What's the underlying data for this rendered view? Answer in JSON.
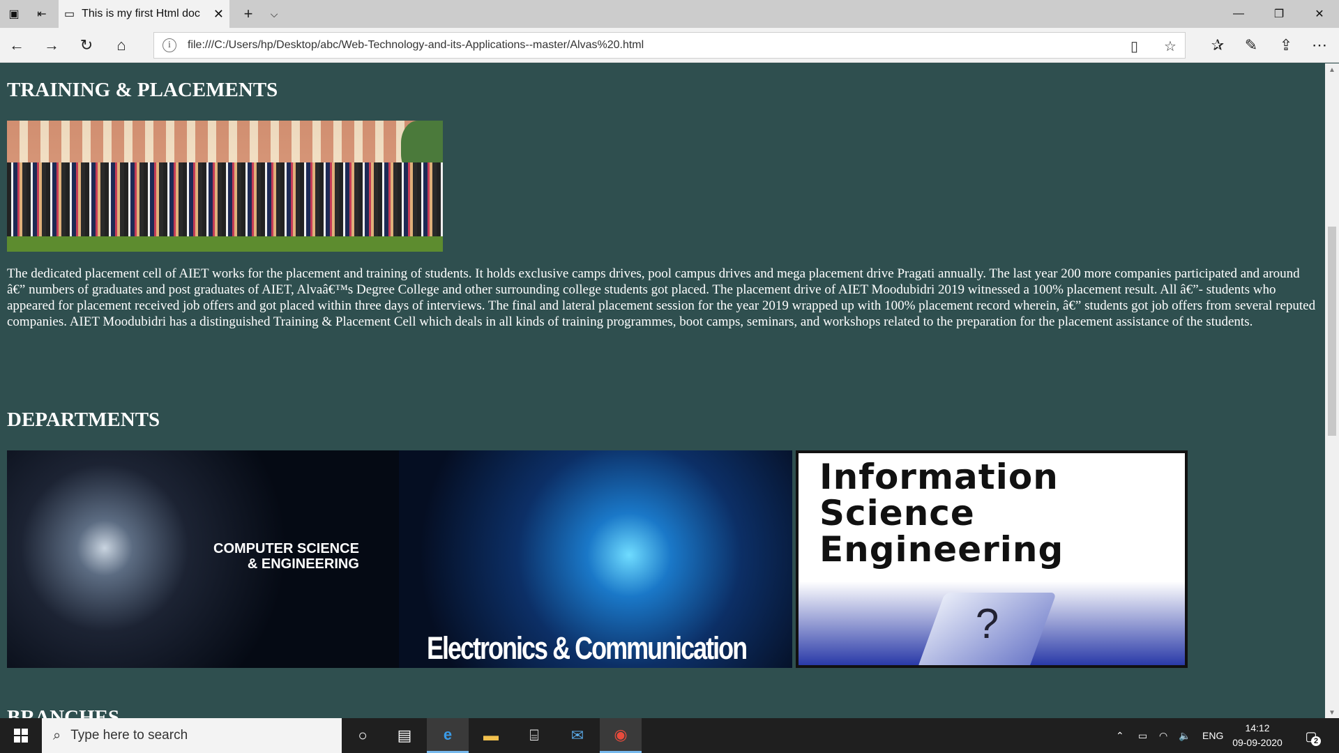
{
  "browser": {
    "tab_title": "This is my first Html doc",
    "tab_close": "✕",
    "new_tab": "+",
    "tab_menu": "⌵",
    "window": {
      "minimize": "—",
      "restore": "❐",
      "close": "✕"
    },
    "address_url": "file:///C:/Users/hp/Desktop/abc/Web-Technology-and-its-Applications--master/Alvas%20.html",
    "icons": [
      "back-icon",
      "forward-icon",
      "refresh-icon",
      "home-icon",
      "info-icon",
      "reading-view-icon",
      "favorite-star-icon",
      "favorites-list-icon",
      "pen-icon",
      "share-icon",
      "more-icon"
    ]
  },
  "page": {
    "training_heading": "TRAINING & PLACEMENTS",
    "training_paragraph": "The dedicated placement cell of AIET works for the placement and training of students. It holds exclusive camps drives, pool campus drives and mega placement drive Pragati annually. The last year 200 more companies participated and around â€” numbers of graduates and post graduates of AIET, Alvaâ€™s Degree College and other surrounding college students got placed. The placement drive of AIET Moodubidri 2019 witnessed a 100% placement result. All â€”- students who appeared for placement received job offers and got placed within three days of interviews. The final and lateral placement session for the year 2019 wrapped up with 100% placement record wherein, â€” students got job offers from several reputed companies. AIET Moodubidri has a distinguished Training & Placement Cell which deals in all kinds of training programmes, boot camps, seminars, and workshops related to the preparation for the placement assistance of the students.",
    "departments_heading": "DEPARTMENTS",
    "dept_cse_line1": "COMPUTER SCIENCE",
    "dept_cse_line2": "& ENGINEERING",
    "dept_ece": "Electronics & Communication Engineering",
    "dept_ise_line1": "Information",
    "dept_ise_line2": "Science",
    "dept_ise_line3": "Engineering",
    "dept_ise_key": "?",
    "branches_heading": "BRANCHES"
  },
  "taskbar": {
    "search_placeholder": "Type here to search",
    "language": "ENG",
    "time": "14:12",
    "date": "09-09-2020",
    "notification_count": "2"
  }
}
